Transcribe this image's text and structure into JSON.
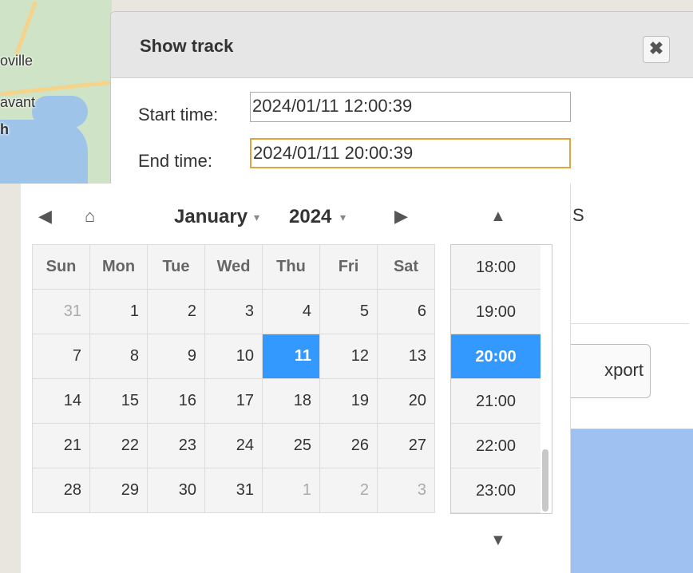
{
  "map": {
    "labels": [
      "oville",
      "avant",
      "h"
    ]
  },
  "dialog": {
    "title": "Show track",
    "close_icon": "close-icon",
    "start_label": "Start time:",
    "start_value": "2024/01/11 12:00:39",
    "end_label": "End time:",
    "end_value": "2024/01/11 20:00:39",
    "partial_text": "S",
    "export_label": "xport",
    "accent_color": "#e0a53c"
  },
  "picker": {
    "prev_icon": "chevron-left-icon",
    "home_icon": "home-icon",
    "next_icon": "chevron-right-icon",
    "month": "January",
    "year": "2024",
    "weekdays": [
      "Sun",
      "Mon",
      "Tue",
      "Wed",
      "Thu",
      "Fri",
      "Sat"
    ],
    "weeks": [
      [
        "31",
        "1",
        "2",
        "3",
        "4",
        "5",
        "6"
      ],
      [
        "7",
        "8",
        "9",
        "10",
        "11",
        "12",
        "13"
      ],
      [
        "14",
        "15",
        "16",
        "17",
        "18",
        "19",
        "20"
      ],
      [
        "21",
        "22",
        "23",
        "24",
        "25",
        "26",
        "27"
      ],
      [
        "28",
        "29",
        "30",
        "31",
        "1",
        "2",
        "3"
      ]
    ],
    "selected_day": "11",
    "times": [
      "18:00",
      "19:00",
      "20:00",
      "21:00",
      "22:00",
      "23:00"
    ],
    "selected_time": "20:00",
    "selection_color": "#3399ff"
  }
}
